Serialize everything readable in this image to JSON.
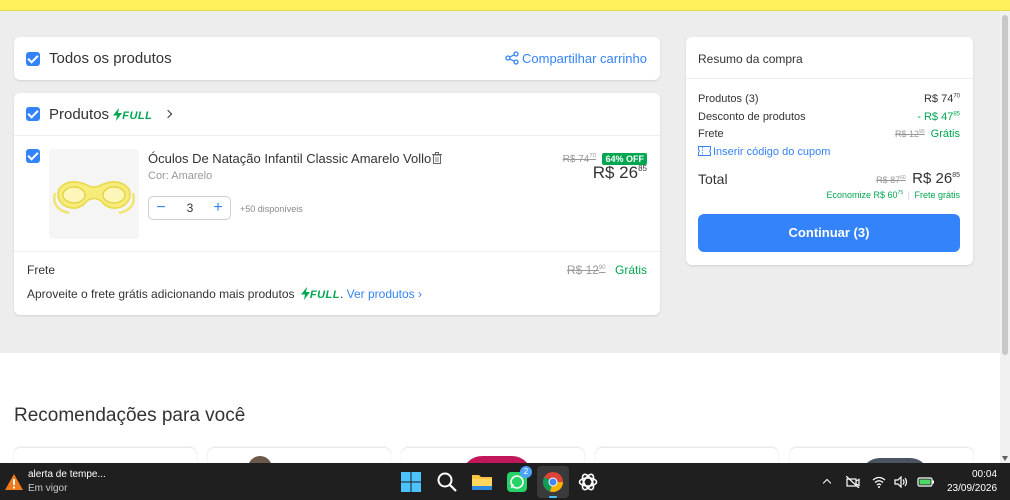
{
  "cart_header": {
    "select_all_label": "Todos os produtos",
    "share_label": "Compartilhar carrinho"
  },
  "products_card": {
    "title": "Produtos",
    "full_label": "FULL",
    "item": {
      "name": "Óculos De Natação Infantil Classic Amarelo Vollo",
      "variant": "Cor: Amarelo",
      "old_price": "R$ 74",
      "old_price_cents": "70",
      "discount_badge": "64% OFF",
      "price": "R$ 26",
      "price_cents": "85",
      "quantity": "3",
      "available": "+50 disponíveis"
    },
    "shipping": {
      "label": "Frete",
      "old_price": "R$ 12",
      "old_price_cents": "90",
      "free_label": "Grátis",
      "promo_text": "Aproveite o frete grátis adicionando mais produtos",
      "promo_full": "FULL",
      "promo_link": "Ver produtos"
    }
  },
  "summary": {
    "title": "Resumo da compra",
    "products_label": "Produtos (3)",
    "products_value": "R$ 74",
    "products_value_cents": "70",
    "discount_label": "Desconto de produtos",
    "discount_value": "- R$ 47",
    "discount_value_cents": "85",
    "shipping_label": "Frete",
    "shipping_old": "R$ 12",
    "shipping_old_cents": "90",
    "shipping_free": "Grátis",
    "coupon_link": "Inserir código do cupom",
    "total_label": "Total",
    "total_old": "R$ 87",
    "total_old_cents": "60",
    "total_value": "R$ 26",
    "total_value_cents": "85",
    "savings": "Economize R$ 60",
    "savings_cents": "75",
    "free_shipping_note": "Frete grátis",
    "continue_button": "Continuar (3)"
  },
  "recommendations": {
    "title": "Recomendações para você"
  },
  "taskbar": {
    "weather_title": "alerta de tempe...",
    "weather_status": "Em vigor",
    "whatsapp_badge": "2",
    "time": "00:04",
    "date": "23/09/2026"
  },
  "colors": {
    "brand_yellow": "#fff159",
    "accent_blue": "#3483fa",
    "green": "#00a650"
  }
}
